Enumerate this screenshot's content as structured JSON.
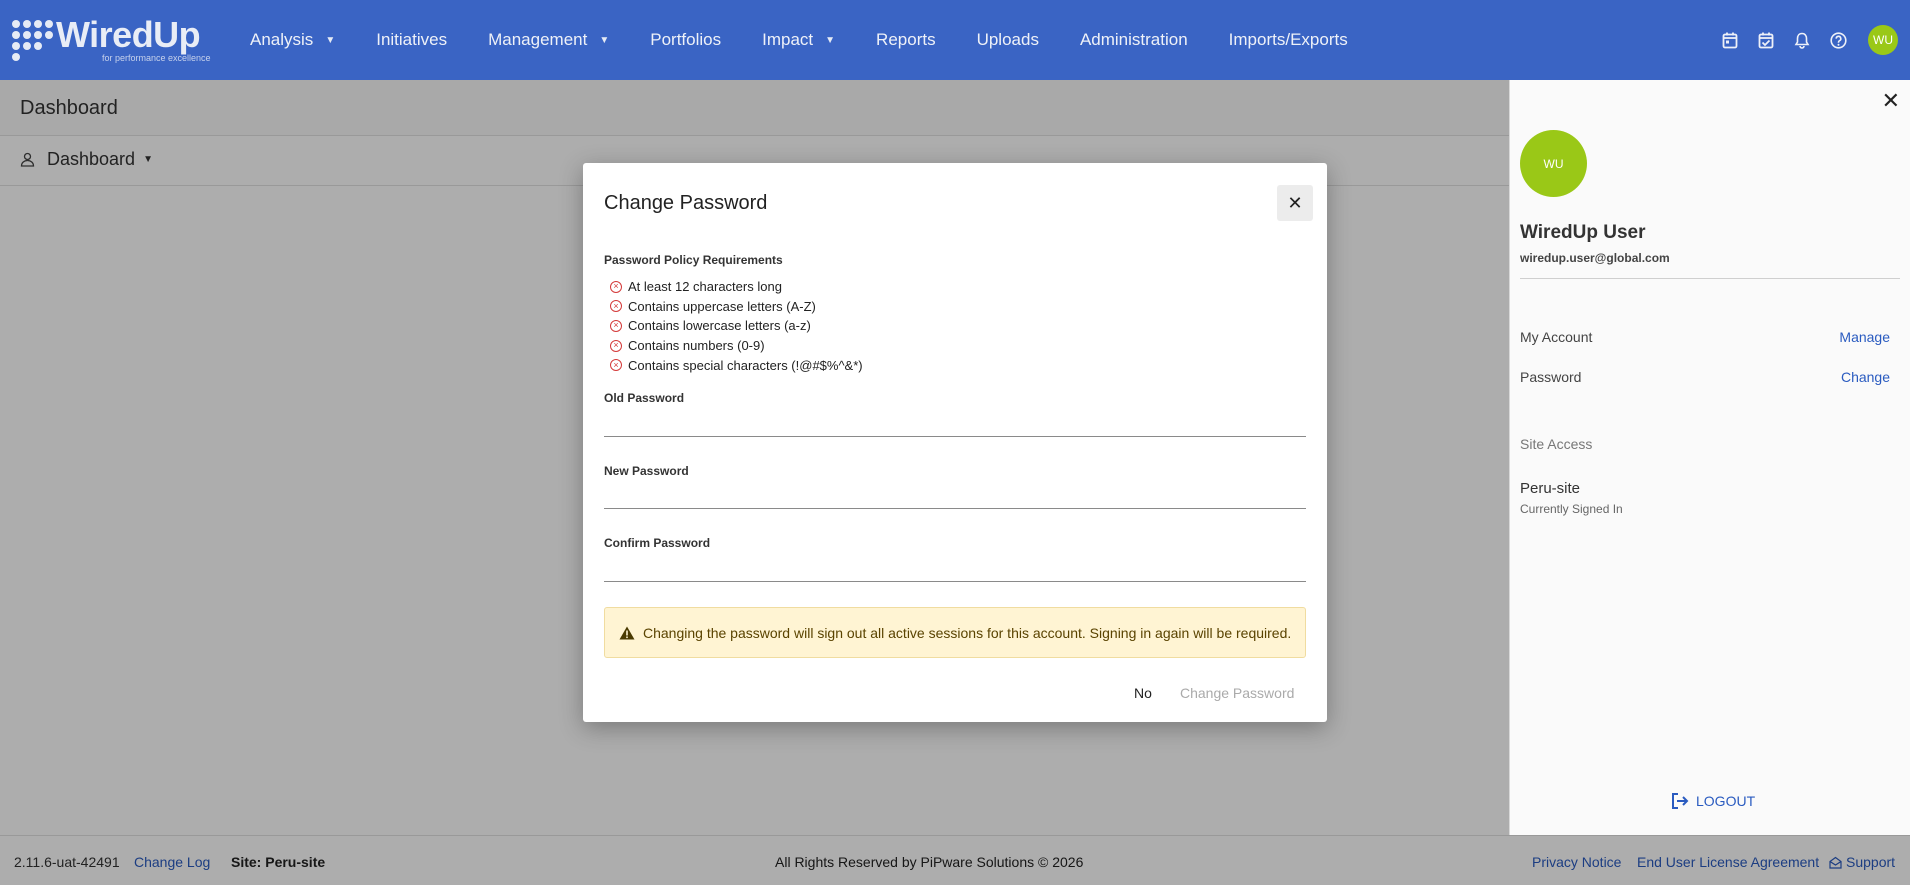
{
  "app": {
    "name": "WiredUp",
    "tagline": "for performance excellence"
  },
  "nav": {
    "items": [
      {
        "label": "Analysis",
        "dropdown": true
      },
      {
        "label": "Initiatives",
        "dropdown": false
      },
      {
        "label": "Management",
        "dropdown": true
      },
      {
        "label": "Portfolios",
        "dropdown": false
      },
      {
        "label": "Impact",
        "dropdown": true
      },
      {
        "label": "Reports",
        "dropdown": false
      },
      {
        "label": "Uploads",
        "dropdown": false
      },
      {
        "label": "Administration",
        "dropdown": false
      },
      {
        "label": "Imports/Exports",
        "dropdown": false
      }
    ],
    "icons": [
      "calendar-icon",
      "calendar-check-icon",
      "bell-icon",
      "help-icon"
    ],
    "avatar_initials": "WU"
  },
  "page": {
    "title": "Dashboard",
    "dashboard_selector": "Dashboard"
  },
  "footer": {
    "version": "2.11.6-uat-42491",
    "change_log": "Change Log",
    "site": "Site: Peru-site",
    "copyright": "All Rights Reserved by PiPware Solutions © 2026",
    "privacy": "Privacy Notice",
    "eula": "End User License Agreement",
    "support": "Support"
  },
  "user_panel": {
    "avatar_initials": "WU",
    "name": "WiredUp User",
    "email": "wiredup.user@global.com",
    "my_account_label": "My Account",
    "my_account_action": "Manage",
    "password_label": "Password",
    "password_action": "Change",
    "site_access_label": "Site Access",
    "site_name": "Peru-site",
    "site_status": "Currently Signed In",
    "logout": "LOGOUT"
  },
  "modal": {
    "title": "Change Password",
    "policy_title": "Password Policy Requirements",
    "policies": [
      "At least 12 characters long",
      "Contains uppercase letters (A-Z)",
      "Contains lowercase letters (a-z)",
      "Contains numbers (0-9)",
      "Contains special characters (!@#$%^&*)"
    ],
    "old_password_label": "Old Password",
    "old_password_value": "",
    "new_password_label": "New Password",
    "new_password_value": "",
    "confirm_password_label": "Confirm Password",
    "confirm_password_value": "",
    "warning": "Changing the password will sign out all active sessions for this account. Signing in again will be required.",
    "no_button": "No",
    "change_button": "Change Password"
  },
  "colors": {
    "navbar": "#3a64c4",
    "avatar": "#9ac817",
    "link": "#2a5bc0",
    "policy_fail": "#d43b3b",
    "warning_bg": "#fff4d3"
  }
}
